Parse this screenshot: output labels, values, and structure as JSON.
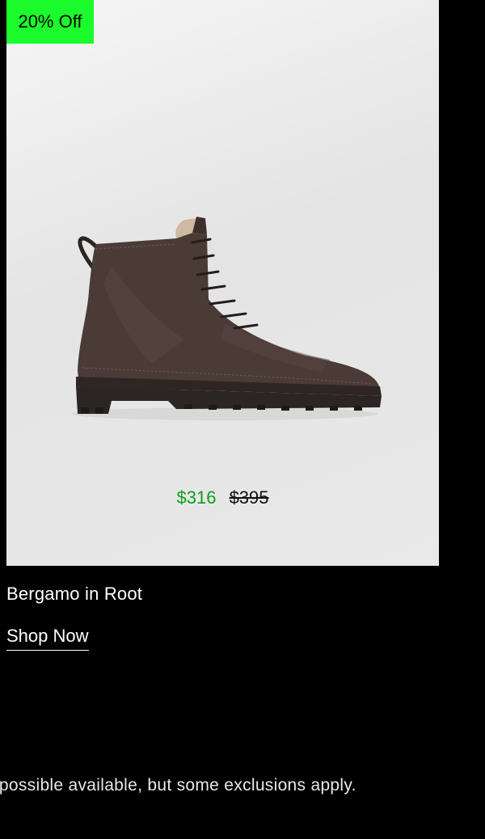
{
  "product": {
    "badge": "20% Off",
    "name": "Bergamo in Root",
    "sale_price": "$316",
    "original_price": "$395",
    "cta_label": "Shop Now"
  },
  "footer": {
    "disclaimer": "luct as possible available, but some exclusions apply."
  },
  "colors": {
    "badge": "#1cfc2c",
    "sale_price": "#0f9d1c",
    "background": "#000000"
  }
}
